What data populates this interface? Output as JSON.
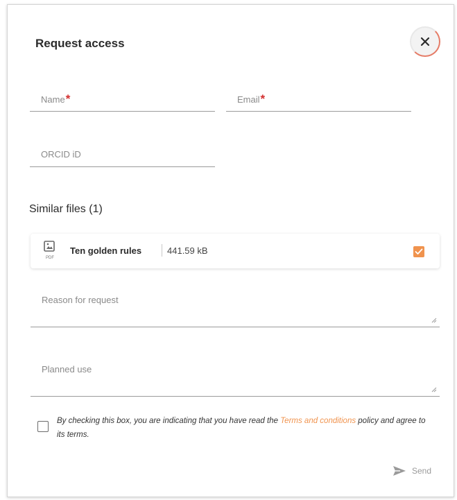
{
  "dialog": {
    "title": "Request access",
    "close_icon": "close-icon"
  },
  "form": {
    "name": {
      "label": "Name",
      "required_mark": "*",
      "value": ""
    },
    "email": {
      "label": "Email",
      "required_mark": "*",
      "value": ""
    },
    "orcid": {
      "label": "ORCID iD",
      "value": ""
    }
  },
  "similar_files": {
    "title": "Similar files (1)",
    "files": [
      {
        "icon": "pdf-file-icon",
        "type_label": "PDF",
        "name": "Ten golden rules",
        "size": "441.59 kB",
        "checked": true
      }
    ]
  },
  "reason": {
    "label": "Reason for request",
    "value": ""
  },
  "planned_use": {
    "label": "Planned use",
    "value": ""
  },
  "consent": {
    "checked": false,
    "text_before": "By checking this box, you are indicating that you have read the ",
    "link_text": "Terms and conditions",
    "text_after": " policy and agree to its terms."
  },
  "actions": {
    "send_label": "Send",
    "send_icon": "send-icon"
  },
  "colors": {
    "accent": "#f0934e",
    "required": "#d32f2f",
    "close_ring": "#e57c67"
  }
}
